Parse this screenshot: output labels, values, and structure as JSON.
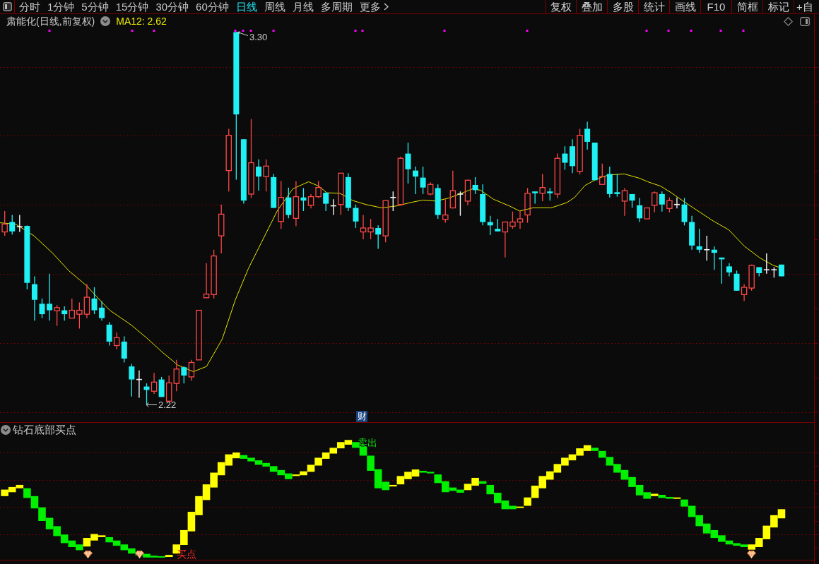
{
  "toolbar": {
    "periods": [
      {
        "label": "分时",
        "kind": "period",
        "selected": false
      },
      {
        "label": "1分钟",
        "kind": "period",
        "selected": false
      },
      {
        "label": "5分钟",
        "kind": "period",
        "selected": false
      },
      {
        "label": "15分钟",
        "kind": "period",
        "selected": false
      },
      {
        "label": "30分钟",
        "kind": "period",
        "selected": false
      },
      {
        "label": "60分钟",
        "kind": "period",
        "selected": false
      },
      {
        "label": "日线",
        "kind": "period",
        "selected": true
      },
      {
        "label": "周线",
        "kind": "period",
        "selected": false
      },
      {
        "label": "月线",
        "kind": "period",
        "selected": false
      },
      {
        "label": "多周期",
        "kind": "period",
        "selected": false
      },
      {
        "label": "更多",
        "kind": "menu",
        "selected": false
      }
    ],
    "tools": [
      "复权",
      "叠加",
      "多股",
      "统计",
      "画线",
      "F10",
      "简框",
      "标记",
      "+自"
    ]
  },
  "price_pane": {
    "title": "肃能化(日线,前复权)",
    "ma_reading": "MA12: 2.62",
    "high_label": "3.30",
    "low_label": "2.22",
    "finance_badge": "财"
  },
  "indicator_pane": {
    "title": "钻石底部买点",
    "signals": [
      {
        "label": "卖出",
        "kind": "sell"
      },
      {
        "label": "买点",
        "kind": "buy"
      }
    ]
  }
}
